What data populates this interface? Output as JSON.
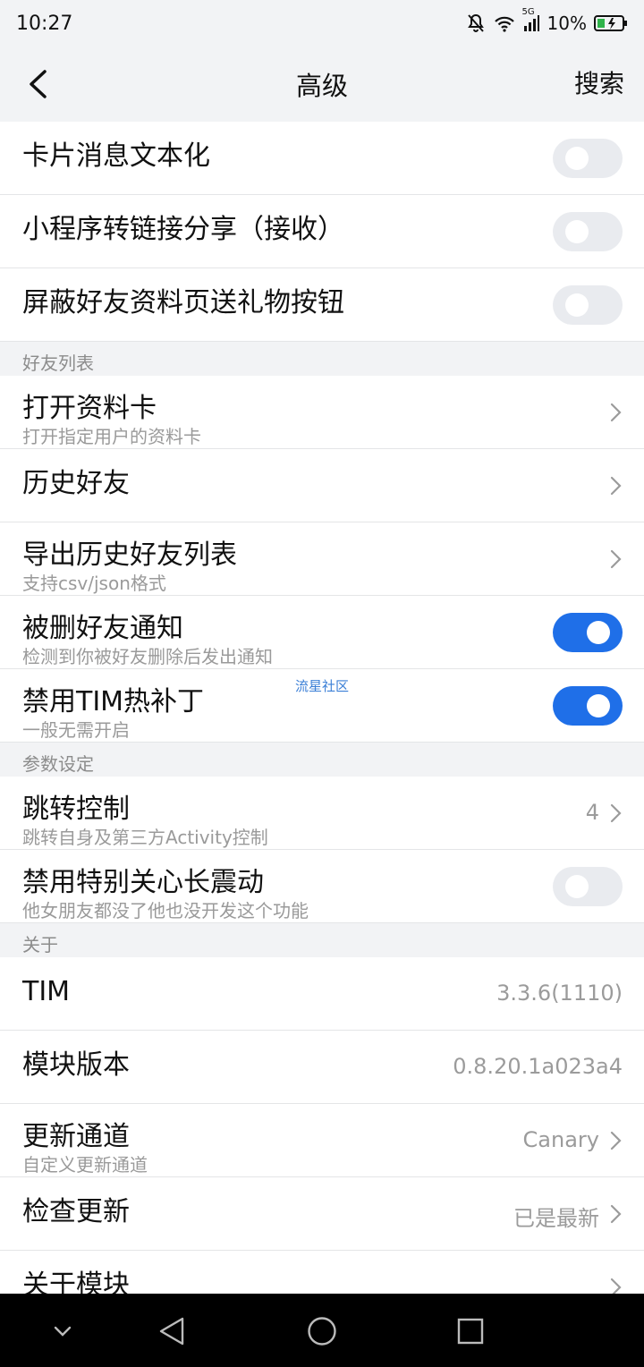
{
  "status": {
    "time": "10:27",
    "network": "5G",
    "battery": "10%"
  },
  "titlebar": {
    "title": "高级",
    "search": "搜索"
  },
  "rows_top": [
    {
      "label": "卡片消息文本化",
      "toggle": false
    },
    {
      "label": "小程序转链接分享（接收）",
      "toggle": false
    },
    {
      "label": "屏蔽好友资料页送礼物按钮",
      "toggle": false
    }
  ],
  "sections": {
    "friends": "好友列表",
    "params": "参数设定",
    "about": "关于"
  },
  "friends": {
    "open_card": {
      "label": "打开资料卡",
      "sub": "打开指定用户的资料卡"
    },
    "history": {
      "label": "历史好友"
    },
    "export": {
      "label": "导出历史好友列表",
      "sub": "支持csv/json格式"
    },
    "deleted_notify": {
      "label": "被删好友通知",
      "sub": "检测到你被好友删除后发出通知",
      "toggle": true
    },
    "disable_hotfix": {
      "label": "禁用TIM热补丁",
      "sub": "一般无需开启",
      "toggle": true
    }
  },
  "watermark": "流星社区",
  "params": {
    "jump": {
      "label": "跳转控制",
      "sub": "跳转自身及第三方Activity控制",
      "value": "4"
    },
    "vibration": {
      "label": "禁用特别关心长震动",
      "sub": "他女朋友都没了他也没开发这个功能",
      "toggle": false
    }
  },
  "about": {
    "tim": {
      "label": "TIM",
      "value": "3.3.6(1110)"
    },
    "module_version": {
      "label": "模块版本",
      "value": "0.8.20.1a023a4"
    },
    "channel": {
      "label": "更新通道",
      "sub": "自定义更新通道",
      "value": "Canary"
    },
    "check_update": {
      "label": "检查更新",
      "value": "已是最新"
    },
    "about_module": {
      "label": "关于模块"
    }
  },
  "colors": {
    "accent": "#1f6fe8",
    "toggle_off": "#e9ebef"
  }
}
